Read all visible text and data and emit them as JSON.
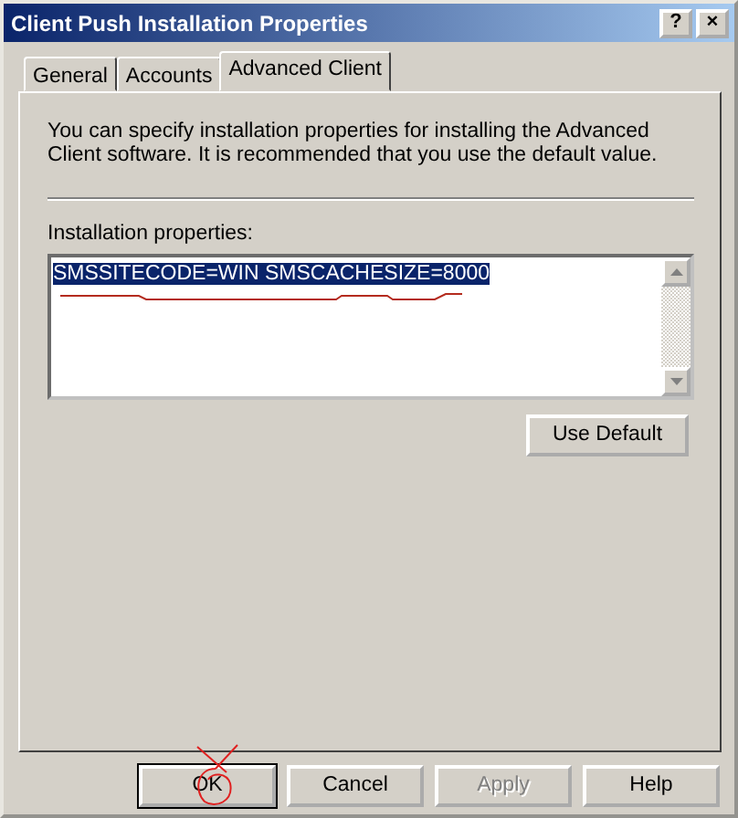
{
  "window": {
    "title": "Client Push Installation Properties",
    "title_buttons": [
      "?",
      "×"
    ]
  },
  "tabs": [
    {
      "label": "General",
      "selected": false
    },
    {
      "label": "Accounts",
      "selected": false
    },
    {
      "label": "Advanced Client",
      "selected": true
    }
  ],
  "description": "You can specify installation properties for installing the Advanced Client software. It is recommended that you use the default value.",
  "properties": {
    "label": "Installation properties:",
    "value": "SMSSITECODE=WIN SMSCACHESIZE=8000",
    "selected": true
  },
  "use_default_button": "Use Default",
  "buttons": [
    {
      "label": "OK",
      "disabled": false,
      "default": true
    },
    {
      "label": "Cancel",
      "disabled": false,
      "default": false
    },
    {
      "label": "Apply",
      "disabled": true,
      "default": false
    },
    {
      "label": "Help",
      "disabled": false,
      "default": false
    }
  ]
}
